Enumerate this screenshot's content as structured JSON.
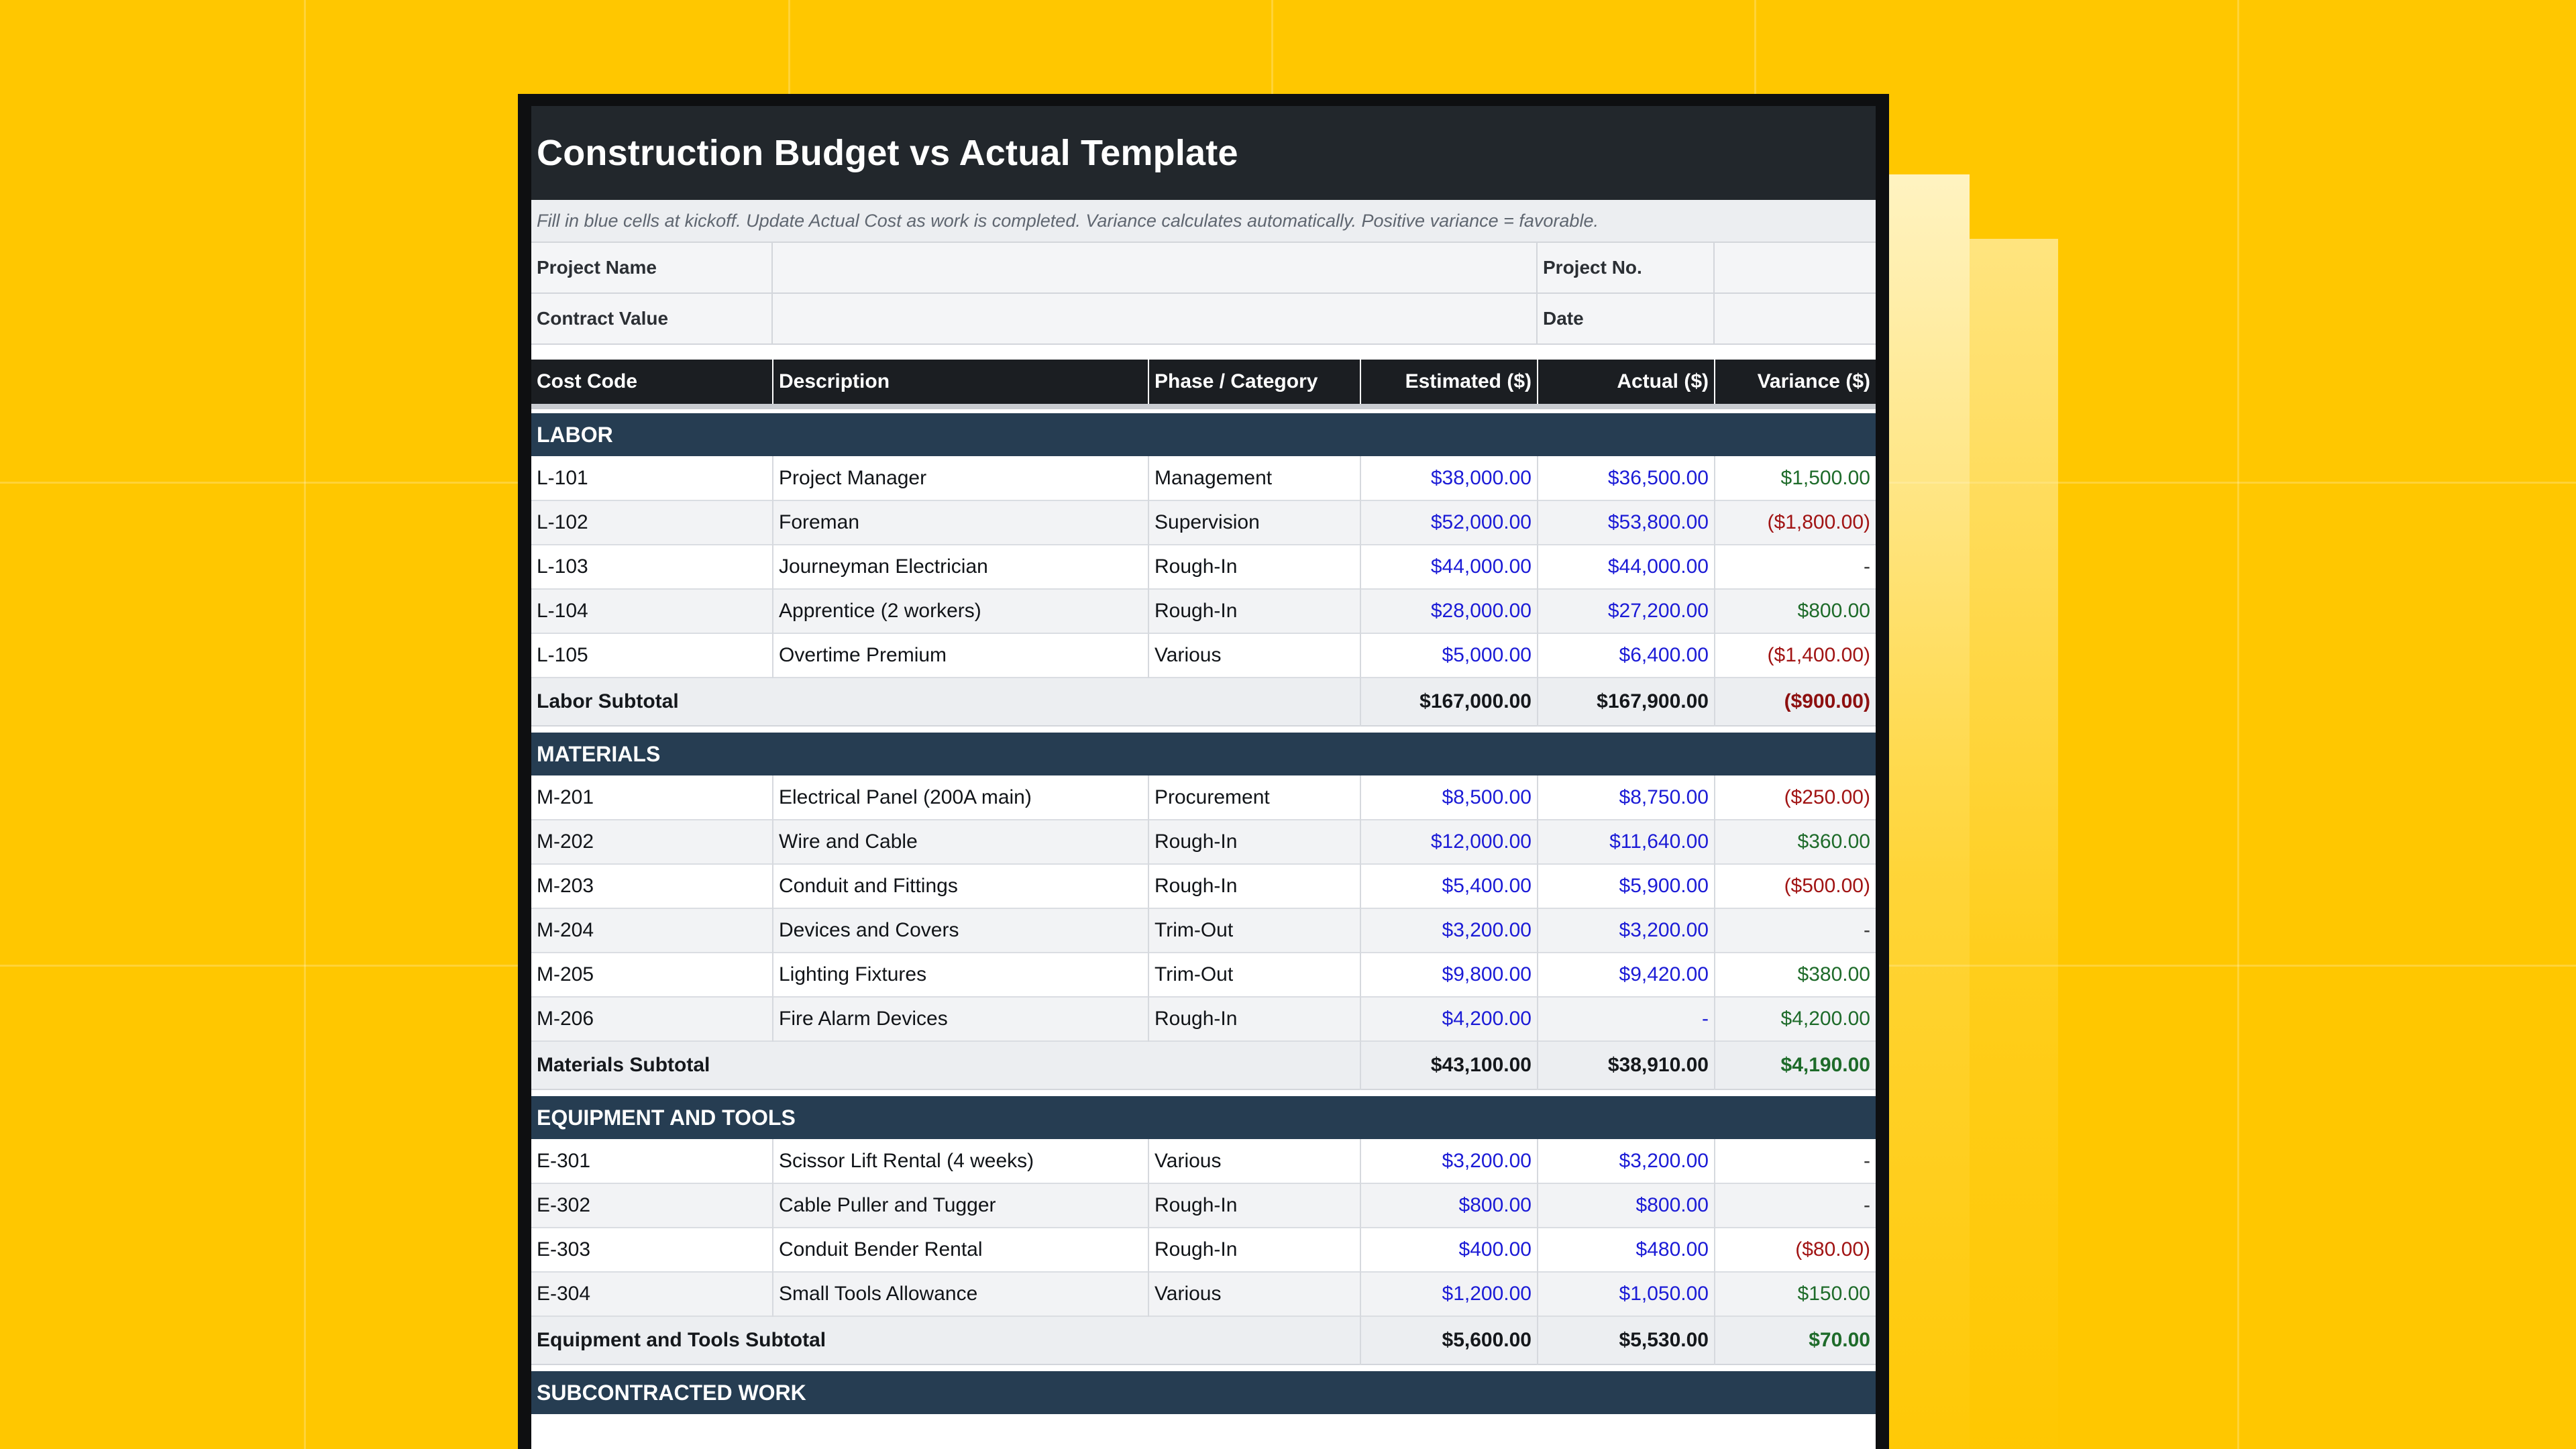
{
  "document": {
    "title": "Construction Budget vs Actual Template",
    "instructions": "Fill in blue cells at kickoff. Update Actual Cost as work is completed. Variance calculates automatically. Positive variance = favorable.",
    "info": {
      "project_name_label": "Project Name",
      "project_name_value": "",
      "project_no_label": "Project No.",
      "project_no_value": "",
      "contract_value_label": "Contract Value",
      "contract_value_value": "",
      "date_label": "Date",
      "date_value": ""
    }
  },
  "table": {
    "headers": {
      "cost_code": "Cost Code",
      "description": "Description",
      "phase": "Phase / Category",
      "estimated": "Estimated ($)",
      "actual": "Actual ($)",
      "variance": "Variance ($)"
    },
    "sections": [
      {
        "name": "LABOR",
        "rows": [
          {
            "code": "L-101",
            "description": "Project Manager",
            "phase": "Management",
            "estimated": "$38,000.00",
            "actual": "$36,500.00",
            "variance": "$1,500.00",
            "status": "fav"
          },
          {
            "code": "L-102",
            "description": "Foreman",
            "phase": "Supervision",
            "estimated": "$52,000.00",
            "actual": "$53,800.00",
            "variance": "($1,800.00)",
            "status": "unfav"
          },
          {
            "code": "L-103",
            "description": "Journeyman Electrician",
            "phase": "Rough-In",
            "estimated": "$44,000.00",
            "actual": "$44,000.00",
            "variance": "-",
            "status": "neutral"
          },
          {
            "code": "L-104",
            "description": "Apprentice (2 workers)",
            "phase": "Rough-In",
            "estimated": "$28,000.00",
            "actual": "$27,200.00",
            "variance": "$800.00",
            "status": "fav"
          },
          {
            "code": "L-105",
            "description": "Overtime Premium",
            "phase": "Various",
            "estimated": "$5,000.00",
            "actual": "$6,400.00",
            "variance": "($1,400.00)",
            "status": "unfav"
          }
        ],
        "subtotal": {
          "label": "Labor Subtotal",
          "estimated": "$167,000.00",
          "actual": "$167,900.00",
          "variance": "($900.00)",
          "status": "unfav"
        }
      },
      {
        "name": "MATERIALS",
        "rows": [
          {
            "code": "M-201",
            "description": "Electrical Panel (200A main)",
            "phase": "Procurement",
            "estimated": "$8,500.00",
            "actual": "$8,750.00",
            "variance": "($250.00)",
            "status": "unfav"
          },
          {
            "code": "M-202",
            "description": "Wire and Cable",
            "phase": "Rough-In",
            "estimated": "$12,000.00",
            "actual": "$11,640.00",
            "variance": "$360.00",
            "status": "fav"
          },
          {
            "code": "M-203",
            "description": "Conduit and Fittings",
            "phase": "Rough-In",
            "estimated": "$5,400.00",
            "actual": "$5,900.00",
            "variance": "($500.00)",
            "status": "unfav"
          },
          {
            "code": "M-204",
            "description": "Devices and Covers",
            "phase": "Trim-Out",
            "estimated": "$3,200.00",
            "actual": "$3,200.00",
            "variance": "-",
            "status": "neutral"
          },
          {
            "code": "M-205",
            "description": "Lighting Fixtures",
            "phase": "Trim-Out",
            "estimated": "$9,800.00",
            "actual": "$9,420.00",
            "variance": "$380.00",
            "status": "fav"
          },
          {
            "code": "M-206",
            "description": "Fire Alarm Devices",
            "phase": "Rough-In",
            "estimated": "$4,200.00",
            "actual": "-",
            "variance": "$4,200.00",
            "status": "fav"
          }
        ],
        "subtotal": {
          "label": "Materials Subtotal",
          "estimated": "$43,100.00",
          "actual": "$38,910.00",
          "variance": "$4,190.00",
          "status": "fav"
        }
      },
      {
        "name": "EQUIPMENT AND TOOLS",
        "rows": [
          {
            "code": "E-301",
            "description": "Scissor Lift Rental (4 weeks)",
            "phase": "Various",
            "estimated": "$3,200.00",
            "actual": "$3,200.00",
            "variance": "-",
            "status": "neutral"
          },
          {
            "code": "E-302",
            "description": "Cable Puller and Tugger",
            "phase": "Rough-In",
            "estimated": "$800.00",
            "actual": "$800.00",
            "variance": "-",
            "status": "neutral"
          },
          {
            "code": "E-303",
            "description": "Conduit Bender Rental",
            "phase": "Rough-In",
            "estimated": "$400.00",
            "actual": "$480.00",
            "variance": "($80.00)",
            "status": "unfav"
          },
          {
            "code": "E-304",
            "description": "Small Tools Allowance",
            "phase": "Various",
            "estimated": "$1,200.00",
            "actual": "$1,050.00",
            "variance": "$150.00",
            "status": "fav"
          }
        ],
        "subtotal": {
          "label": "Equipment and Tools Subtotal",
          "estimated": "$5,600.00",
          "actual": "$5,530.00",
          "variance": "$70.00",
          "status": "fav"
        }
      },
      {
        "name": "SUBCONTRACTED WORK",
        "rows": [],
        "subtotal": null
      }
    ]
  },
  "colors": {
    "background": "#ffc700",
    "title_bar": "#22272c",
    "section_header": "#263d52",
    "input_blue": "#1b1bd6",
    "favorable_green": "#1e6b2a",
    "unfavorable_red": "#a11414"
  }
}
